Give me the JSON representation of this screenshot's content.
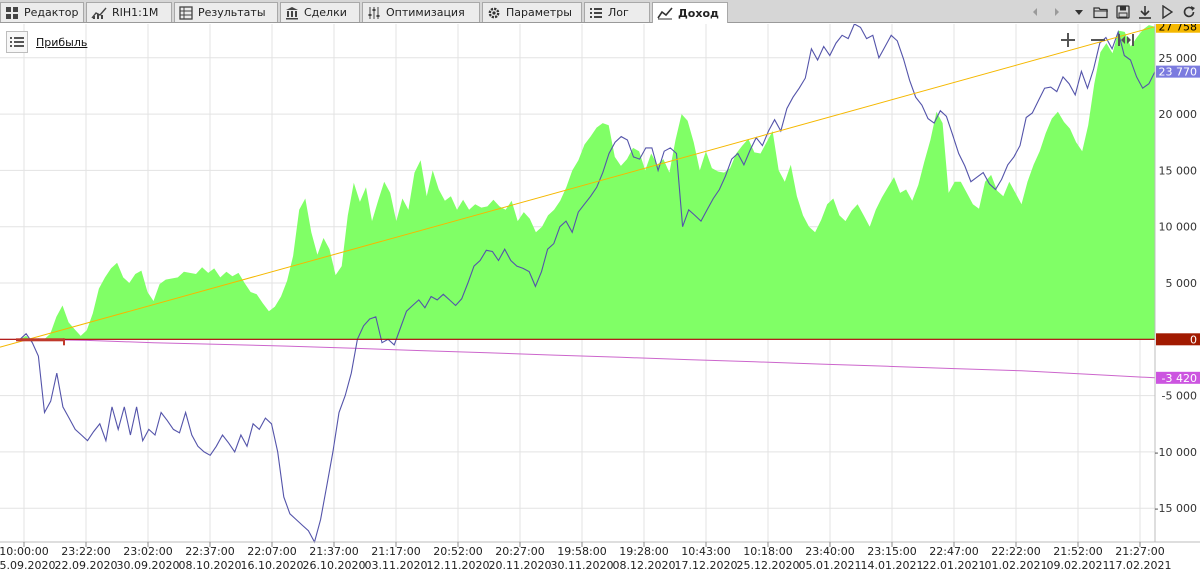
{
  "tabs": [
    {
      "label": "Редактор",
      "icon": "grid-icon",
      "active": false
    },
    {
      "label": "RIH1:1M",
      "icon": "chart-bars-icon",
      "active": false
    },
    {
      "label": "Результаты",
      "icon": "table-icon",
      "active": false
    },
    {
      "label": "Сделки",
      "icon": "bank-icon",
      "active": false
    },
    {
      "label": "Оптимизация",
      "icon": "sliders-icon",
      "active": false
    },
    {
      "label": "Параметры",
      "icon": "gear-icon",
      "active": false
    },
    {
      "label": "Лог",
      "icon": "list-icon",
      "active": false
    },
    {
      "label": "Доход",
      "icon": "line-chart-icon",
      "active": true
    }
  ],
  "toolbar_icons": [
    "nav-prev-icon",
    "nav-next-icon",
    "chevron-down-icon",
    "open-folder-icon",
    "save-icon",
    "download-icon",
    "play-icon",
    "refresh-icon"
  ],
  "legend": {
    "label": "Прибыль"
  },
  "chart_controls": [
    "zoom-in-icon",
    "zoom-out-icon",
    "fit-icon"
  ],
  "chart_data": {
    "type": "area",
    "y_ticks": [
      25000,
      20000,
      15000,
      10000,
      5000,
      0,
      -5000,
      -10000,
      -15000
    ],
    "y_tick_labels": [
      "25 000",
      "20 000",
      "15 000",
      "10 000",
      "5 000",
      "0",
      "-5 000",
      "-10 000",
      "-15 000"
    ],
    "ylim": [
      -18000,
      28000
    ],
    "x_tick_labels": [
      {
        "time": "10:00:00",
        "date": "15.09.2020"
      },
      {
        "time": "23:22:00",
        "date": "22.09.2020"
      },
      {
        "time": "23:02:00",
        "date": "30.09.2020"
      },
      {
        "time": "22:37:00",
        "date": "08.10.2020"
      },
      {
        "time": "22:07:00",
        "date": "16.10.2020"
      },
      {
        "time": "21:37:00",
        "date": "26.10.2020"
      },
      {
        "time": "21:17:00",
        "date": "03.11.2020"
      },
      {
        "time": "20:52:00",
        "date": "12.11.2020"
      },
      {
        "time": "20:27:00",
        "date": "20.11.2020"
      },
      {
        "time": "19:58:00",
        "date": "30.11.2020"
      },
      {
        "time": "19:28:00",
        "date": "08.12.2020"
      },
      {
        "time": "10:43:00",
        "date": "17.12.2020"
      },
      {
        "time": "10:18:00",
        "date": "25.12.2020"
      },
      {
        "time": "23:40:00",
        "date": "05.01.2021"
      },
      {
        "time": "23:15:00",
        "date": "14.01.2021"
      },
      {
        "time": "22:47:00",
        "date": "22.01.2021"
      },
      {
        "time": "22:22:00",
        "date": "01.02.2021"
      },
      {
        "time": "21:52:00",
        "date": "09.02.2021"
      },
      {
        "time": "21:27:00",
        "date": "17.02.2021"
      }
    ],
    "grid": true,
    "series": [
      {
        "kind": "area",
        "color": "#80ff66",
        "values": [
          0,
          300,
          -200,
          100,
          0,
          500,
          2000,
          3000,
          1500,
          900,
          300,
          800,
          2300,
          4500,
          5500,
          6300,
          6800,
          5500,
          5000,
          5800,
          6100,
          4200,
          3400,
          4900,
          5300,
          5400,
          5500,
          6000,
          5900,
          5800,
          6400,
          5900,
          6300,
          5500,
          6000,
          5600,
          5900,
          5000,
          4200,
          4000,
          3200,
          2500,
          2900,
          3800,
          5200,
          7400,
          11500,
          12500,
          9500,
          7500,
          9000,
          8000,
          5700,
          6500,
          11000,
          13900,
          12200,
          13500,
          10500,
          12300,
          14000,
          13000,
          10500,
          12500,
          11500,
          14800,
          15900,
          12700,
          15000,
          13300,
          12300,
          12700,
          11500,
          12400,
          11500,
          12000,
          11700,
          11800,
          12400,
          11800,
          11500,
          12300,
          10500,
          11300,
          10700,
          9500,
          10000,
          11000,
          11500,
          12300,
          13500,
          15000,
          15900,
          17300,
          18000,
          18800,
          19200,
          19000,
          16200,
          15400,
          16000,
          17000,
          16700,
          15000,
          16500,
          15500,
          16000,
          14800,
          17700,
          20000,
          19400,
          17500,
          15000,
          16700,
          15200,
          14900,
          14800,
          15200,
          16500,
          17200,
          17800,
          16600,
          16500,
          17500,
          18500,
          15000,
          14000,
          15500,
          12700,
          11000,
          10000,
          9500,
          10600,
          12000,
          12500,
          11000,
          10500,
          11400,
          12000,
          11000,
          10000,
          11500,
          12600,
          13500,
          14400,
          13000,
          13300,
          12300,
          13700,
          15800,
          17700,
          20200,
          19200,
          13000,
          14000,
          14000,
          13000,
          12000,
          11600,
          14000,
          14600,
          13200,
          12700,
          14000,
          13000,
          12000,
          14000,
          15500,
          16700,
          18300,
          19600,
          20200,
          19300,
          18700,
          17500,
          16700,
          19000,
          22700,
          25500,
          26300,
          25400,
          27400,
          27300,
          26000,
          26800,
          27500,
          27900,
          27758
        ]
      },
      {
        "kind": "line",
        "color": "#5454aa",
        "values": [
          0,
          500,
          -300,
          -1500,
          -6500,
          -5500,
          -3000,
          -6000,
          -7000,
          -8000,
          -8500,
          -9000,
          -8200,
          -7500,
          -9000,
          -6000,
          -8000,
          -6000,
          -8500,
          -6000,
          -9000,
          -8000,
          -8500,
          -6500,
          -7200,
          -8000,
          -8300,
          -6500,
          -8500,
          -9500,
          -10000,
          -10300,
          -9500,
          -8500,
          -9200,
          -10000,
          -8500,
          -9500,
          -7500,
          -8000,
          -7000,
          -7500,
          -10000,
          -14000,
          -15500,
          -16000,
          -16500,
          -17000,
          -18000,
          -16000,
          -13000,
          -10000,
          -6500,
          -5000,
          -3000,
          0,
          1200,
          1800,
          2000,
          -300,
          0,
          -500,
          1000,
          2500,
          3000,
          3500,
          2800,
          3800,
          3500,
          4000,
          3500,
          3000,
          3600,
          5000,
          6500,
          7000,
          7900,
          7800,
          7000,
          8000,
          7000,
          6500,
          6300,
          6000,
          4700,
          6000,
          8000,
          8500,
          10000,
          10500,
          9500,
          11300,
          12000,
          12700,
          13500,
          14800,
          16500,
          17500,
          18000,
          17700,
          16200,
          16000,
          17000,
          17000,
          15000,
          16700,
          17000,
          16500,
          10000,
          11500,
          11000,
          10500,
          11500,
          12500,
          13300,
          14500,
          16000,
          16500,
          15500,
          16800,
          17900,
          17200,
          18500,
          19500,
          18500,
          20500,
          21500,
          22300,
          23200,
          25800,
          24800,
          26000,
          25200,
          26300,
          27000,
          26700,
          28000,
          27700,
          26700,
          27000,
          25000,
          26000,
          27000,
          26500,
          24900,
          23000,
          21500,
          20800,
          19600,
          19200,
          20300,
          19800,
          18200,
          16500,
          15400,
          14000,
          14400,
          14800,
          13800,
          13300,
          14200,
          15500,
          16200,
          17200,
          19700,
          20100,
          21200,
          22300,
          22400,
          22000,
          23300,
          22700,
          21700,
          23800,
          22300,
          24000,
          26300,
          26800,
          25800,
          27300,
          25200,
          24800,
          23300,
          22300,
          22700,
          23770
        ]
      },
      {
        "kind": "line",
        "color": "#f5b800",
        "values": [
          -700,
          27758
        ]
      },
      {
        "kind": "line",
        "color": "#cc66cc",
        "values": [
          0,
          -100,
          -300,
          -450,
          -600,
          -800,
          -1000,
          -1200,
          -1400,
          -1600,
          -1800,
          -2000,
          -2200,
          -2400,
          -2600,
          -2800,
          -3100,
          -3420
        ]
      },
      {
        "kind": "line",
        "color": "#aa0000",
        "values": [
          0,
          0
        ]
      }
    ],
    "value_badges": [
      {
        "label": "27 758",
        "color": "#f5b800"
      },
      {
        "label": "23 770",
        "color": "#7b7bdf"
      },
      {
        "label": "0",
        "color": "#a11a00"
      },
      {
        "label": "-3 420",
        "color": "#cc55e0"
      }
    ]
  }
}
